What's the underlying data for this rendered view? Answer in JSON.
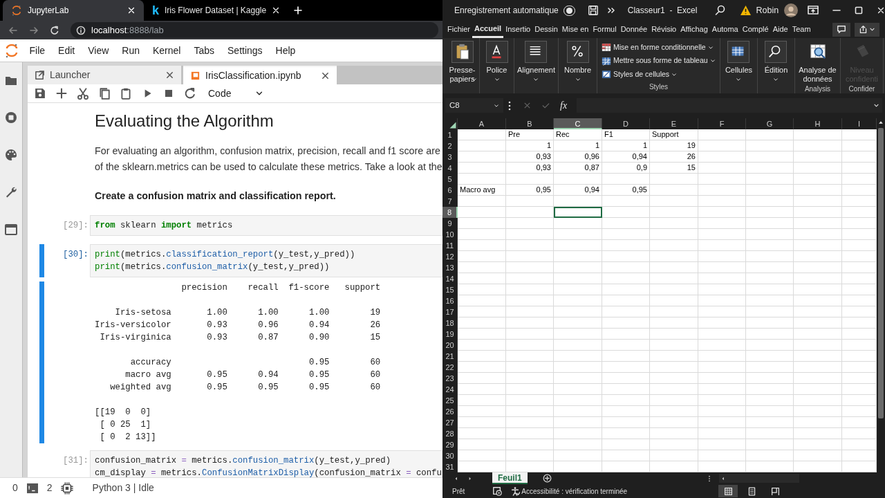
{
  "browser": {
    "tabs": [
      {
        "label": "JupyterLab",
        "selected": true,
        "kind": "jupyter"
      },
      {
        "label": "Iris Flower Dataset | Kaggle",
        "selected": false,
        "kind": "kaggle",
        "logo": "k"
      }
    ],
    "address": {
      "host": "localhost",
      "path": ":8888/lab"
    }
  },
  "jupyter": {
    "menu": [
      "File",
      "Edit",
      "View",
      "Run",
      "Kernel",
      "Tabs",
      "Settings",
      "Help"
    ],
    "doc_tabs": [
      {
        "label": "Launcher",
        "selected": false,
        "kind": "launcher"
      },
      {
        "label": "IrisClassification.ipynb",
        "selected": true,
        "kind": "notebook"
      }
    ],
    "cell_type": "Code",
    "cells": [
      {
        "kind": "heading",
        "text": "Evaluating the Algorithm"
      },
      {
        "kind": "paragraph",
        "lines": [
          "For evaluating an algorithm, confusion matrix, precision, recall and f1 score are",
          "of the sklearn.metrics can be used to calculate these metrics. Take a look at the"
        ]
      },
      {
        "kind": "bold",
        "text": "Create a confusion matrix and classification report."
      },
      {
        "kind": "code",
        "prompt": "[29]:",
        "selected": false,
        "lines": [
          [
            {
              "t": "from",
              "kind": "kw"
            },
            {
              "t": " sklearn ",
              "kind": "plain"
            },
            {
              "t": "import",
              "kind": "kw"
            },
            {
              "t": " metrics",
              "kind": "plain"
            }
          ]
        ]
      },
      {
        "kind": "code",
        "prompt": "[30]:",
        "selected": true,
        "lines": [
          [
            {
              "t": "print",
              "kind": "builtin"
            },
            {
              "t": "(metrics.",
              "kind": "plain"
            },
            {
              "t": "classification_report",
              "kind": "fn"
            },
            {
              "t": "(y_test,y_pred))",
              "kind": "plain"
            }
          ],
          [
            {
              "t": "print",
              "kind": "builtin"
            },
            {
              "t": "(metrics.",
              "kind": "plain"
            },
            {
              "t": "confusion_matrix",
              "kind": "fn"
            },
            {
              "t": "(y_test,y_pred))",
              "kind": "plain"
            }
          ]
        ],
        "output": [
          [
            "                 precision    recall  f1-score   support"
          ],
          [
            "    Iris-setosa       1.00      1.00      1.00        19",
            "Iris-versicolor       0.93      0.96      0.94        26",
            " Iris-virginica       0.93      0.87      0.90        15"
          ],
          [
            "       accuracy                           0.95        60",
            "      macro avg       0.95      0.94      0.95        60",
            "   weighted avg       0.95      0.95      0.95        60"
          ],
          [
            "[[19  0  0]",
            " [ 0 25  1]",
            " [ 0  2 13]]"
          ]
        ]
      },
      {
        "kind": "code",
        "prompt": "[31]:",
        "selected": false,
        "lines": [
          [
            {
              "t": "confusion_matrix ",
              "kind": "plain"
            },
            {
              "t": "=",
              "kind": "op"
            },
            {
              "t": " metrics.",
              "kind": "plain"
            },
            {
              "t": "confusion_matrix",
              "kind": "fn"
            },
            {
              "t": "(y_test,y_pred)",
              "kind": "plain"
            }
          ],
          [
            {
              "t": "cm_display ",
              "kind": "plain"
            },
            {
              "t": "=",
              "kind": "op"
            },
            {
              "t": " metrics.",
              "kind": "plain"
            },
            {
              "t": "ConfusionMatrixDisplay",
              "kind": "fn"
            },
            {
              "t": "(confusion_matrix ",
              "kind": "plain"
            },
            {
              "t": "=",
              "kind": "op"
            },
            {
              "t": " confu",
              "kind": "plain"
            }
          ]
        ]
      }
    ],
    "status": {
      "terminals": "0",
      "kernels": "2",
      "kernel": "Python 3 | Idle"
    }
  },
  "excel": {
    "autosave": {
      "label": "Enregistrement automatique",
      "on": false
    },
    "title": "Classeur1  -  Excel",
    "user": "Robin",
    "ribbon_tabs": [
      {
        "label": "Fichier",
        "selected": false
      },
      {
        "label": "Accueil",
        "selected": true
      },
      {
        "label": "Insertio",
        "selected": false
      },
      {
        "label": "Dessin",
        "selected": false
      },
      {
        "label": "Mise en",
        "selected": false
      },
      {
        "label": "Formul",
        "selected": false
      },
      {
        "label": "Donnée",
        "selected": false
      },
      {
        "label": "Révisio",
        "selected": false
      },
      {
        "label": "Affichag",
        "selected": false
      },
      {
        "label": "Automa",
        "selected": false
      },
      {
        "label": "Complé",
        "selected": false
      },
      {
        "label": "Aide",
        "selected": false
      },
      {
        "label": "Team",
        "selected": false
      }
    ],
    "ribbon": [
      {
        "kind": "clipboard",
        "label": "Presse-papiers",
        "dropdown": true
      },
      {
        "kind": "font",
        "label": "Police",
        "dropdown": true
      },
      {
        "kind": "align",
        "label": "Alignement",
        "dropdown": true
      },
      {
        "kind": "number",
        "label": "Nombre",
        "dropdown": true
      },
      {
        "kind": "styles",
        "group": "Styles",
        "items": [
          {
            "kind": "conditional",
            "label": "Mise en forme conditionnelle"
          },
          {
            "kind": "table",
            "label": "Mettre sous forme de tableau"
          },
          {
            "kind": "cellstyle",
            "label": "Styles de cellules"
          }
        ]
      },
      {
        "kind": "cells",
        "label": "Cellules",
        "dropdown": true
      },
      {
        "kind": "edit",
        "label": "Édition",
        "dropdown": true
      },
      {
        "kind": "analysis",
        "label": "Analyse de données",
        "dropdown": false,
        "group": "Analysis"
      },
      {
        "kind": "sensitivity",
        "label": "Niveau confidenti",
        "dropdown": false,
        "disabled": true,
        "group": "Confider"
      }
    ],
    "name_box": "C8",
    "function_symbol": "fx",
    "grid": {
      "columns": [
        {
          "label": "A",
          "selected": false
        },
        {
          "label": "B",
          "selected": false
        },
        {
          "label": "C",
          "selected": true
        },
        {
          "label": "D",
          "selected": false
        },
        {
          "label": "E",
          "selected": false
        },
        {
          "label": "F",
          "selected": false
        },
        {
          "label": "G",
          "selected": false
        },
        {
          "label": "H",
          "selected": false
        },
        {
          "label": "I",
          "selected": false
        }
      ],
      "rows": [
        {
          "label": "1",
          "selected": false,
          "cells": [
            {},
            {
              "text": "Pre",
              "kind": "text"
            },
            {
              "text": "Rec",
              "kind": "text"
            },
            {
              "text": "F1",
              "kind": "text"
            },
            {
              "text": "Support",
              "kind": "text"
            }
          ]
        },
        {
          "label": "2",
          "selected": false,
          "cells": [
            {},
            {
              "text": "1",
              "kind": "number"
            },
            {
              "text": "1",
              "kind": "number"
            },
            {
              "text": "1",
              "kind": "number"
            },
            {
              "text": "19",
              "kind": "number"
            }
          ]
        },
        {
          "label": "3",
          "selected": false,
          "cells": [
            {},
            {
              "text": "0,93",
              "kind": "number"
            },
            {
              "text": "0,96",
              "kind": "number"
            },
            {
              "text": "0,94",
              "kind": "number"
            },
            {
              "text": "26",
              "kind": "number"
            }
          ]
        },
        {
          "label": "4",
          "selected": false,
          "cells": [
            {},
            {
              "text": "0,93",
              "kind": "number"
            },
            {
              "text": "0,87",
              "kind": "number"
            },
            {
              "text": "0,9",
              "kind": "number"
            },
            {
              "text": "15",
              "kind": "number"
            }
          ]
        },
        {
          "label": "5",
          "selected": false
        },
        {
          "label": "6",
          "selected": false,
          "cells": [
            {
              "text": "Macro avg",
              "kind": "text"
            },
            {
              "text": "0,95",
              "kind": "number"
            },
            {
              "text": "0,94",
              "kind": "number"
            },
            {
              "text": "0,95",
              "kind": "number"
            }
          ]
        },
        {
          "label": "7",
          "selected": false
        },
        {
          "label": "8",
          "selected": true
        },
        {
          "label": "9",
          "selected": false
        },
        {
          "label": "10",
          "selected": false
        },
        {
          "label": "11",
          "selected": false
        },
        {
          "label": "12",
          "selected": false
        },
        {
          "label": "13",
          "selected": false
        },
        {
          "label": "14",
          "selected": false
        },
        {
          "label": "15",
          "selected": false
        },
        {
          "label": "16",
          "selected": false
        },
        {
          "label": "17",
          "selected": false
        },
        {
          "label": "18",
          "selected": false
        },
        {
          "label": "19",
          "selected": false
        },
        {
          "label": "20",
          "selected": false
        },
        {
          "label": "21",
          "selected": false
        },
        {
          "label": "22",
          "selected": false
        },
        {
          "label": "23",
          "selected": false
        },
        {
          "label": "24",
          "selected": false
        },
        {
          "label": "25",
          "selected": false
        },
        {
          "label": "26",
          "selected": false
        },
        {
          "label": "27",
          "selected": false
        },
        {
          "label": "28",
          "selected": false
        },
        {
          "label": "29",
          "selected": false
        },
        {
          "label": "30",
          "selected": false
        },
        {
          "label": "31",
          "selected": false
        }
      ]
    },
    "sheets": [
      {
        "label": "Feuil1",
        "selected": true
      }
    ],
    "status": {
      "ready": "Prêt",
      "accessibility": "Accessibilité : vérification terminée"
    },
    "views": [
      {
        "kind": "normal",
        "selected": true
      },
      {
        "kind": "layout",
        "selected": false
      },
      {
        "kind": "pagebreak",
        "selected": false
      }
    ]
  }
}
